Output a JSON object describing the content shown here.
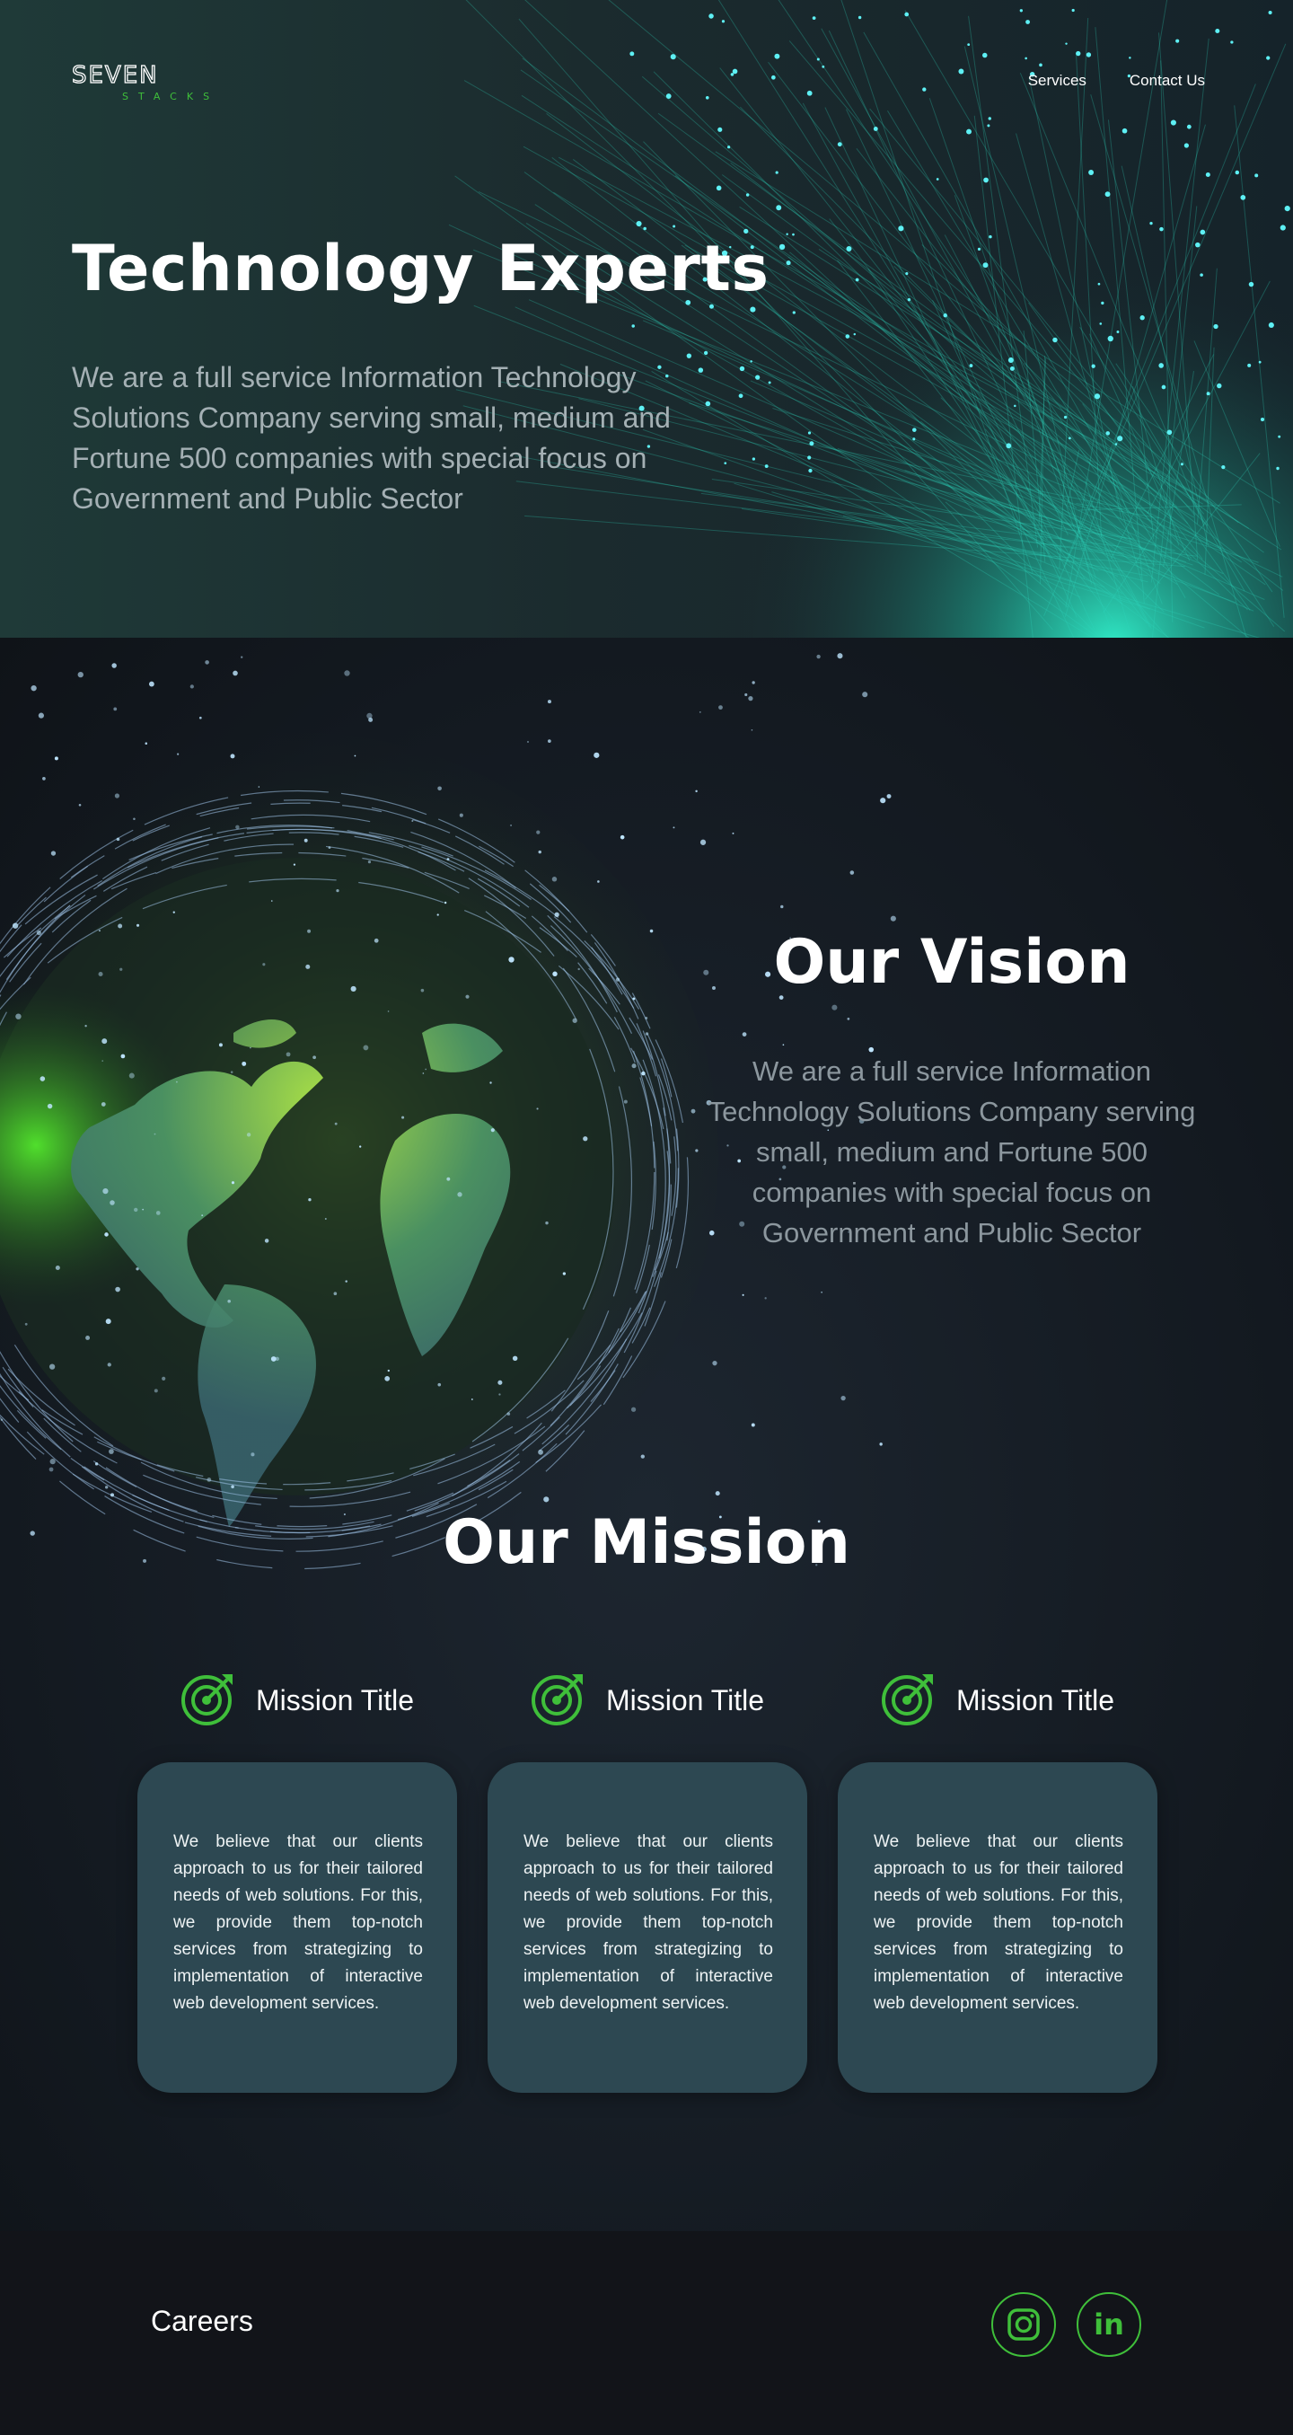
{
  "brand": {
    "logo_word": "SEVEN",
    "logo_sub": "STACKS",
    "accent": "#3fbf3a",
    "teal": "#2de0c8"
  },
  "nav": {
    "items": [
      "Services",
      "Contact Us"
    ]
  },
  "hero": {
    "title": "Technology Experts",
    "text": "We are a full service Information Technology Solutions Company serving small, medium and Fortune 500 companies with special focus on Government and Public Sector"
  },
  "vision": {
    "title": "Our Vision",
    "text": "We are a full service Information Technology Solutions Company serving small, medium and Fortune 500 companies with special focus on Government and Public Sector"
  },
  "mission": {
    "title": "Our Mission",
    "items": [
      {
        "icon": "target-icon",
        "title": "Mission Title",
        "text": "We believe that our clients approach to us for their tailored needs of web solutions. For this, we provide them top-notch services from strategizing to implementation of interactive web development services."
      },
      {
        "icon": "target-icon",
        "title": "Mission Title",
        "text": "We believe that our clients approach to us for their tailored needs of web solutions. For this, we provide them top-notch services from strategizing to implementation of interactive web development services."
      },
      {
        "icon": "target-icon",
        "title": "Mission Title",
        "text": "We believe that our clients approach to us for their tailored needs of web solutions. For this, we provide them top-notch services from strategizing to implementation of interactive web development services."
      }
    ]
  },
  "footer": {
    "link": "Careers",
    "social": [
      "instagram-icon",
      "linkedin-icon"
    ],
    "linkedin_glyph": "in"
  }
}
